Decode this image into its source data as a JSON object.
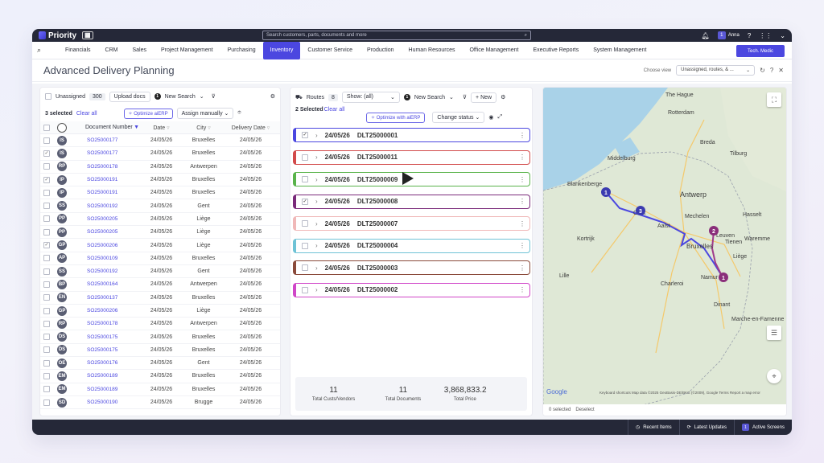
{
  "app": {
    "brand": "Priority",
    "search_placeholder": "Search customers, parts, documents and more",
    "user_name": "Anna",
    "user_badge": "1"
  },
  "menu": {
    "items": [
      "Financials",
      "CRM",
      "Sales",
      "Project Management",
      "Purchasing",
      "Inventory",
      "Customer Service",
      "Production",
      "Human Resources",
      "Office Management",
      "Executive Reports",
      "System Management"
    ],
    "active": "Inventory",
    "tech_button": "Tech. Medic"
  },
  "page": {
    "title": "Advanced Delivery Planning",
    "choose_view_label": "Choose view",
    "choose_view_value": "Unassigned, routes, & ..."
  },
  "left_panel": {
    "unassigned_label": "Unassigned",
    "unassigned_count": "300",
    "upload_docs": "Upload docs",
    "new_search": "New Search",
    "new_search_badge": "1",
    "selected_text": "3 selected",
    "clear_all": "Clear all",
    "optimize": "Optimize aiERP",
    "assign_manually": "Assign manually",
    "columns": [
      "Document Number",
      "Date",
      "City",
      "Delivery Date"
    ],
    "rows": [
      {
        "checked": false,
        "avatar": "IS",
        "doc": "SO25000177",
        "date": "24/05/26",
        "city": "Bruxelles",
        "delivery": "24/05/26"
      },
      {
        "checked": true,
        "avatar": "IS",
        "doc": "SO25000177",
        "date": "24/05/26",
        "city": "Bruxelles",
        "delivery": "24/05/26"
      },
      {
        "checked": false,
        "avatar": "RP",
        "doc": "SO25000178",
        "date": "24/05/26",
        "city": "Antwerpen",
        "delivery": "24/05/26"
      },
      {
        "checked": true,
        "avatar": "IP",
        "doc": "SO25000191",
        "date": "24/05/26",
        "city": "Bruxelles",
        "delivery": "24/05/26"
      },
      {
        "checked": false,
        "avatar": "IP",
        "doc": "SO25000191",
        "date": "24/05/26",
        "city": "Bruxelles",
        "delivery": "24/05/26"
      },
      {
        "checked": false,
        "avatar": "SS",
        "doc": "SO25000192",
        "date": "24/05/26",
        "city": "Gent",
        "delivery": "24/05/26"
      },
      {
        "checked": false,
        "avatar": "PP",
        "doc": "SO25000205",
        "date": "24/05/26",
        "city": "Liège",
        "delivery": "24/05/26"
      },
      {
        "checked": false,
        "avatar": "PP",
        "doc": "SO25000205",
        "date": "24/05/26",
        "city": "Liège",
        "delivery": "24/05/26"
      },
      {
        "checked": true,
        "avatar": "GP",
        "doc": "SO25000206",
        "date": "24/05/26",
        "city": "Liège",
        "delivery": "24/05/26"
      },
      {
        "checked": false,
        "avatar": "AP",
        "doc": "SO25000109",
        "date": "24/05/26",
        "city": "Bruxelles",
        "delivery": "24/05/26"
      },
      {
        "checked": false,
        "avatar": "SS",
        "doc": "SO25000192",
        "date": "24/05/26",
        "city": "Gent",
        "delivery": "24/05/26"
      },
      {
        "checked": false,
        "avatar": "BP",
        "doc": "SO25000164",
        "date": "24/05/26",
        "city": "Antwerpen",
        "delivery": "24/05/26"
      },
      {
        "checked": false,
        "avatar": "EN",
        "doc": "SO25000137",
        "date": "24/05/26",
        "city": "Bruxelles",
        "delivery": "24/05/26"
      },
      {
        "checked": false,
        "avatar": "GP",
        "doc": "SO25000206",
        "date": "24/05/26",
        "city": "Liège",
        "delivery": "24/05/26"
      },
      {
        "checked": false,
        "avatar": "RP",
        "doc": "SO25000178",
        "date": "24/05/26",
        "city": "Antwerpen",
        "delivery": "24/05/26"
      },
      {
        "checked": false,
        "avatar": "DS",
        "doc": "SO25000175",
        "date": "24/05/26",
        "city": "Bruxelles",
        "delivery": "24/05/26"
      },
      {
        "checked": false,
        "avatar": "DS",
        "doc": "SO25000175",
        "date": "24/05/26",
        "city": "Bruxelles",
        "delivery": "24/05/26"
      },
      {
        "checked": false,
        "avatar": "OE",
        "doc": "SO25000176",
        "date": "24/05/26",
        "city": "Gent",
        "delivery": "24/05/26"
      },
      {
        "checked": false,
        "avatar": "EM",
        "doc": "SO25000189",
        "date": "24/05/26",
        "city": "Bruxelles",
        "delivery": "24/05/26"
      },
      {
        "checked": false,
        "avatar": "EM",
        "doc": "SO25000189",
        "date": "24/05/26",
        "city": "Bruxelles",
        "delivery": "24/05/26"
      },
      {
        "checked": false,
        "avatar": "SD",
        "doc": "SO25000190",
        "date": "24/05/26",
        "city": "Brugge",
        "delivery": "24/05/26"
      }
    ]
  },
  "middle_panel": {
    "routes_label": "Routes",
    "routes_count": "8",
    "show_value": "Show: (all)",
    "new_search": "New Search",
    "new_search_badge": "1",
    "new_button": "New",
    "selected_text": "2 Selected",
    "clear_all": "Clear all",
    "optimize": "Optimize with aiERP",
    "change_status": "Change status",
    "routes": [
      {
        "checked": true,
        "date": "24/05/26",
        "id": "DLT25000001",
        "color": "#4b47e0"
      },
      {
        "checked": false,
        "date": "24/05/26",
        "id": "DLT25000011",
        "color": "#d24a4a"
      },
      {
        "checked": false,
        "date": "24/05/26",
        "id": "DLT25000009",
        "color": "#59b34a"
      },
      {
        "checked": true,
        "date": "24/05/26",
        "id": "DLT25000008",
        "color": "#7a2a7a"
      },
      {
        "checked": false,
        "date": "24/05/26",
        "id": "DLT25000007",
        "color": "#f0b8b8"
      },
      {
        "checked": false,
        "date": "24/05/26",
        "id": "DLT25000004",
        "color": "#6fc3d6"
      },
      {
        "checked": false,
        "date": "24/05/26",
        "id": "DLT25000003",
        "color": "#8a4a3a"
      },
      {
        "checked": false,
        "date": "24/05/26",
        "id": "DLT25000002",
        "color": "#d046c8"
      }
    ],
    "stats": [
      {
        "value": "11",
        "label": "Total Custs/Vendors"
      },
      {
        "value": "11",
        "label": "Total Documents"
      },
      {
        "value": "3,868,833.2",
        "label": "Total Price"
      }
    ]
  },
  "map": {
    "place_labels": [
      "The Hague",
      "Rotterdam",
      "Breda",
      "Tilburg",
      "Antwerp",
      "Gent",
      "Bruxelles",
      "Charleroi",
      "Namur",
      "Liège",
      "Dinant",
      "Lille",
      "Kortrijk",
      "Mechelen",
      "Leuven",
      "Hasselt",
      "Aalst",
      "Middelburg",
      "Blankenberge",
      "Tienen",
      "Waremme",
      "Marche-en-Famenne"
    ],
    "markers": [
      "1",
      "3",
      "2",
      "1"
    ],
    "selected_text": "0 selected",
    "deselect": "Deselect",
    "google": "Google",
    "attribution": "Keyboard shortcuts   Map data ©2025 GeoBasis-DE/BKG (©2009), Google   Terms   Report a map error"
  },
  "bottom_bar": {
    "items": [
      "Recent Items",
      "Latest Updates",
      "Active Screens"
    ],
    "active_screens_badge": "1"
  }
}
